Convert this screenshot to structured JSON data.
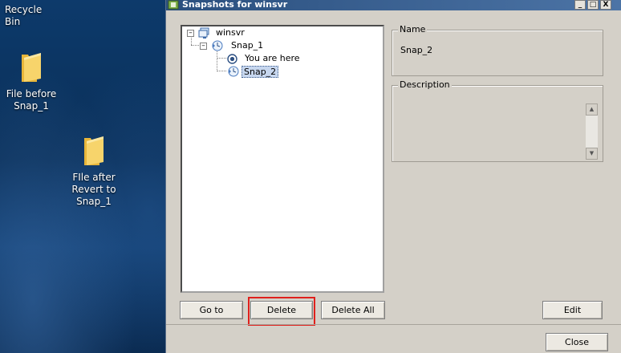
{
  "desktop": {
    "icons": [
      {
        "label": "Recycle Bin"
      },
      {
        "label": "File before Snap_1",
        "line1": "File before",
        "line2": "Snap_1"
      },
      {
        "label": "FIle after Revert to Snap_1",
        "line1": "FIle after",
        "line2": "Revert to",
        "line3": "Snap_1"
      }
    ]
  },
  "dialog": {
    "title": "Snapshots for winsvr",
    "window_controls": {
      "minimize": "_",
      "maximize": "□",
      "close": "X"
    },
    "tree": {
      "root": "winsvr",
      "snap1": "Snap_1",
      "you_are_here": "You are here",
      "snap2": "Snap_2",
      "selected": "Snap_2"
    },
    "name_group": {
      "title": "Name",
      "value": "Snap_2"
    },
    "description_group": {
      "title": "Description",
      "value": ""
    },
    "buttons": {
      "goto": "Go to",
      "delete": "Delete",
      "delete_all": "Delete All",
      "edit": "Edit",
      "close": "Close"
    },
    "highlight_color": "#e0201c",
    "title_bar_color": "#2a4f7e"
  }
}
